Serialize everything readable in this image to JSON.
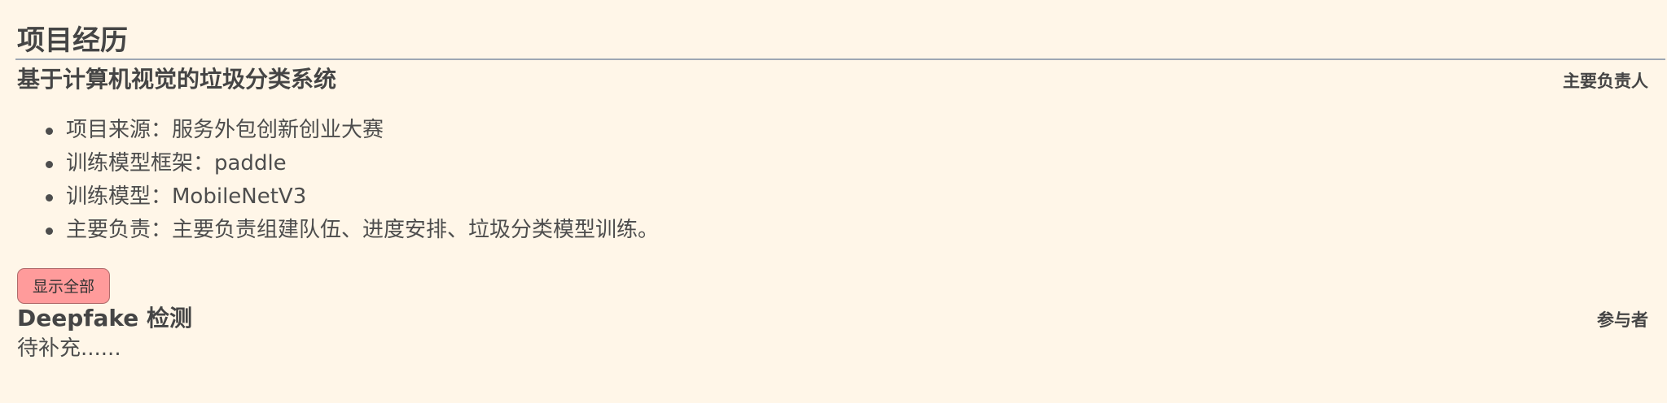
{
  "section": {
    "title": "项目经历"
  },
  "projects": [
    {
      "title": "基于计算机视觉的垃圾分类系统",
      "role": "主要负责人",
      "details": [
        "项目来源：服务外包创新创业大赛",
        "训练模型框架：paddle",
        "训练模型：MobileNetV3",
        "主要负责：主要负责组建队伍、进度安排、垃圾分类模型训练。"
      ],
      "show_all_label": "显示全部"
    },
    {
      "title": "Deepfake 检测",
      "role": "参与者",
      "description": "待补充......"
    }
  ],
  "colors": {
    "background": "#fff6e8",
    "button_bg": "#ff9b9b",
    "rule": "#9ea7b3"
  }
}
